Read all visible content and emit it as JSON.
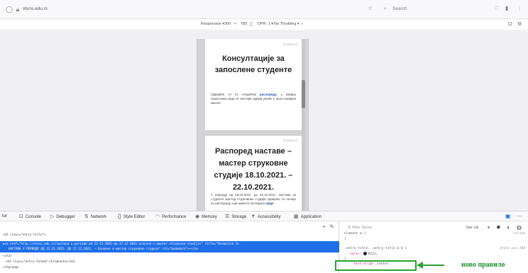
{
  "browser": {
    "url": "vtsns.edu.rs",
    "search_placeholder": "Search"
  },
  "responsive": {
    "mode": "Responsive ▾",
    "width": "360",
    "sep": "×",
    "height": "780",
    "dpr": "DPR: 1 ▾",
    "throttle": "No Throttling ▾"
  },
  "page": {
    "card1": {
      "category": "ISTAKNUTO",
      "title": "Консултације за запослене студенте",
      "body_before": "Одвијаће се по следећем",
      "link": "распореду",
      "body_after": ", у оквиру недељама када се настава одвија уживо у просторијама Школе."
    },
    "card2": {
      "category": "ISTAKNUTO",
      "title": "Распоред наставе – мастер струковне студије 18.10.2021. – 22.10.2021.",
      "body_before": "У периоду од 18.10.2021. до 22.10.2021. настава за студенте мастер струковних студија одвијаће се онлајн по распореду који можете погледати",
      "link": "овде"
    }
  },
  "devtools": {
    "tabs": [
      "tor",
      "Console",
      "Debugger",
      "Network",
      "Style Editor",
      "Performance",
      "Memory",
      "Storage",
      "Accessibility",
      "Application"
    ],
    "markup_lines": [
      "<h2 class=\"entry-title\">",
      "▶<a href=\"http://vtsns.edu.rs/nastava-u-periodu-od-13-12-2021-do-17-12-2021-osnovne-i-master-strukovne-studije/\" title=\"Permalink to",
      "НАСТАВА У ПЕРИОДУ ОД 13.12.2021. ДО 17.12.2021. – Основне и мастер струковне студије\" rel=\"bookmark\">⋯</a>",
      "</h2>",
      "<h3 class=\"entry-format\">Istaknuto</h3>",
      "</hgroup>"
    ],
    "rules": {
      "filter_placeholder": "Filter Styles",
      "toggles": ":hov  .cls",
      "element_selector": "element ⚙ {",
      "element_source": "inline",
      "rule_selector": ".entry-title, .entry-title a ⚙ {",
      "rule_source": "style.css:784",
      "color_prop": "color:",
      "color_value": "#222;",
      "align_prop": "text-align:",
      "align_value": "center;"
    }
  },
  "annotation": "ново правило"
}
